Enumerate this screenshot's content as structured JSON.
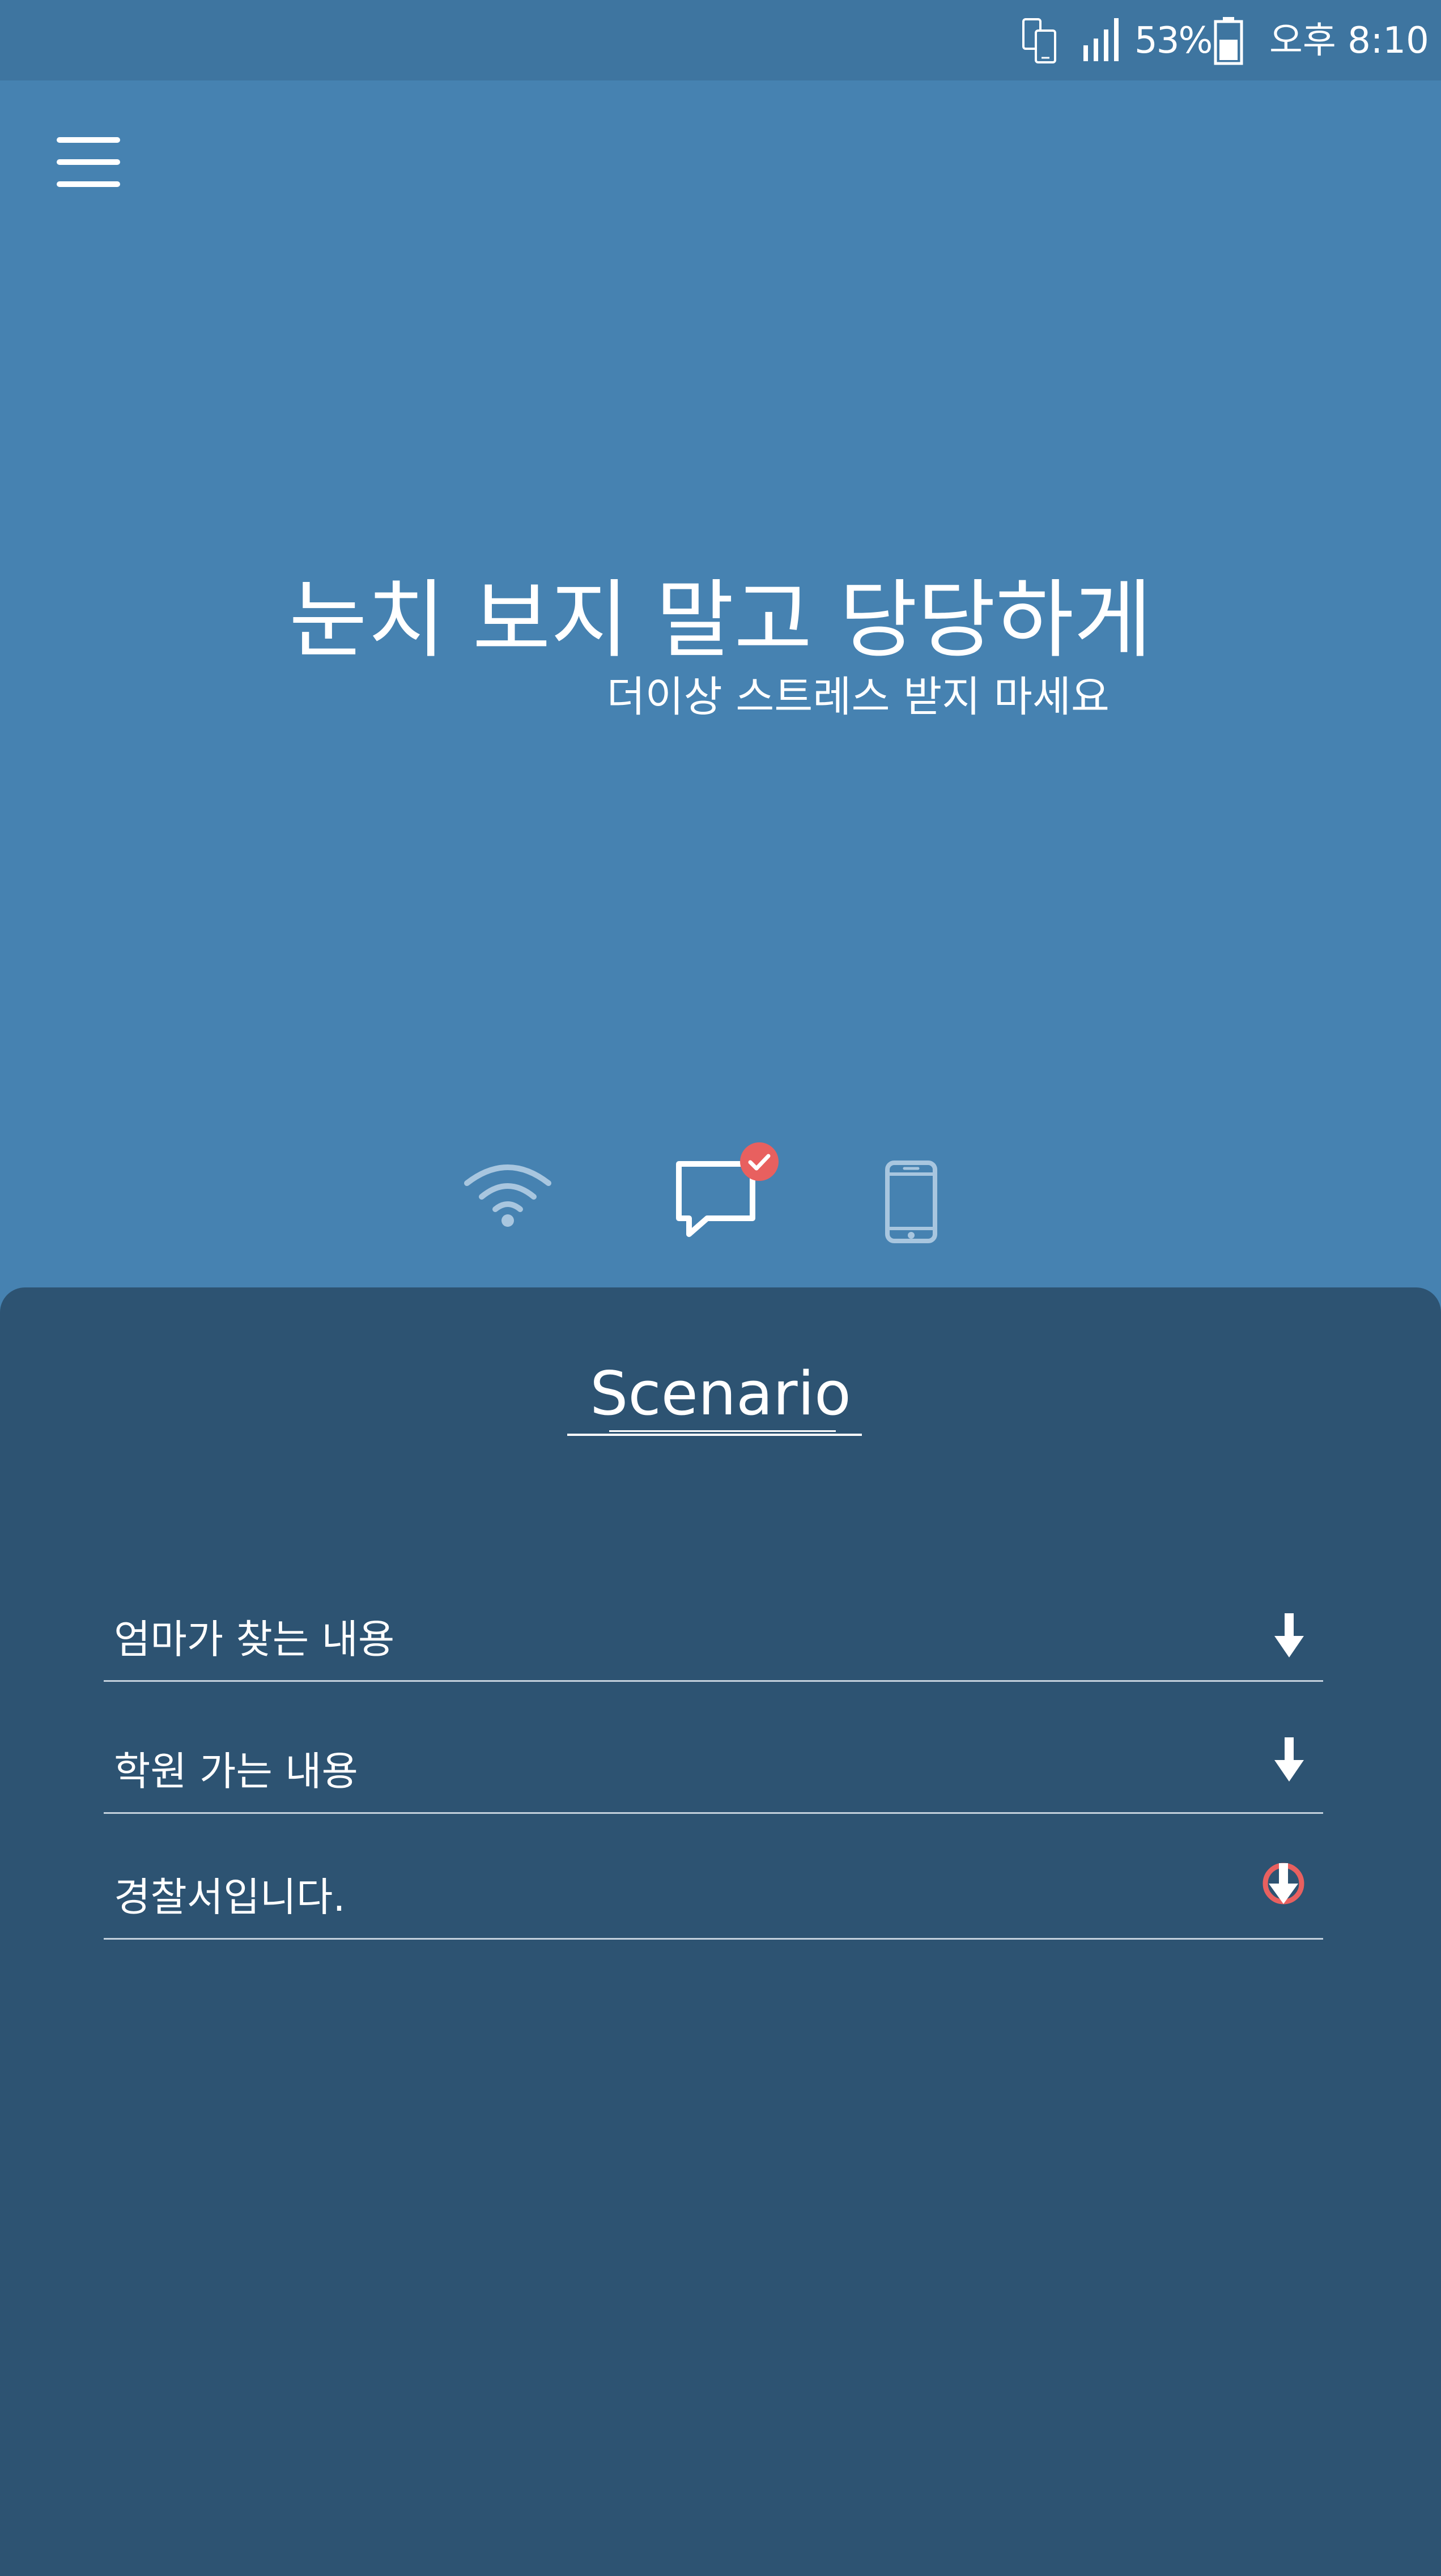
{
  "status_bar": {
    "battery_percent": "53%",
    "time": "오후 8:10",
    "icons": [
      "phone-sync-icon",
      "signal-icon",
      "battery-icon"
    ]
  },
  "header": {
    "menu_icon": "hamburger-menu-icon"
  },
  "hero": {
    "headline": "눈치 보지 말고 당당하게",
    "subline": "더이상 스트레스 받지 마세요"
  },
  "modes": [
    {
      "name": "wifi",
      "icon": "wifi-icon",
      "selected": false
    },
    {
      "name": "message",
      "icon": "message-icon",
      "selected": true
    },
    {
      "name": "phone",
      "icon": "phone-icon",
      "selected": false
    }
  ],
  "scenario": {
    "title": "Scenario",
    "items": [
      {
        "label": "엄마가 찾는 내용",
        "icon": "download-arrow-icon",
        "active": false
      },
      {
        "label": "학원 가는 내용",
        "icon": "download-arrow-icon",
        "active": false
      },
      {
        "label": "경찰서입니다.",
        "icon": "download-arrow-icon",
        "active": true
      }
    ]
  },
  "colors": {
    "hero_background": "#4682b1",
    "status_bar": "#3e75a0",
    "panel_background": "#2d5372",
    "accent": "#e8605f",
    "inactive_icon": "#a8c6df"
  }
}
